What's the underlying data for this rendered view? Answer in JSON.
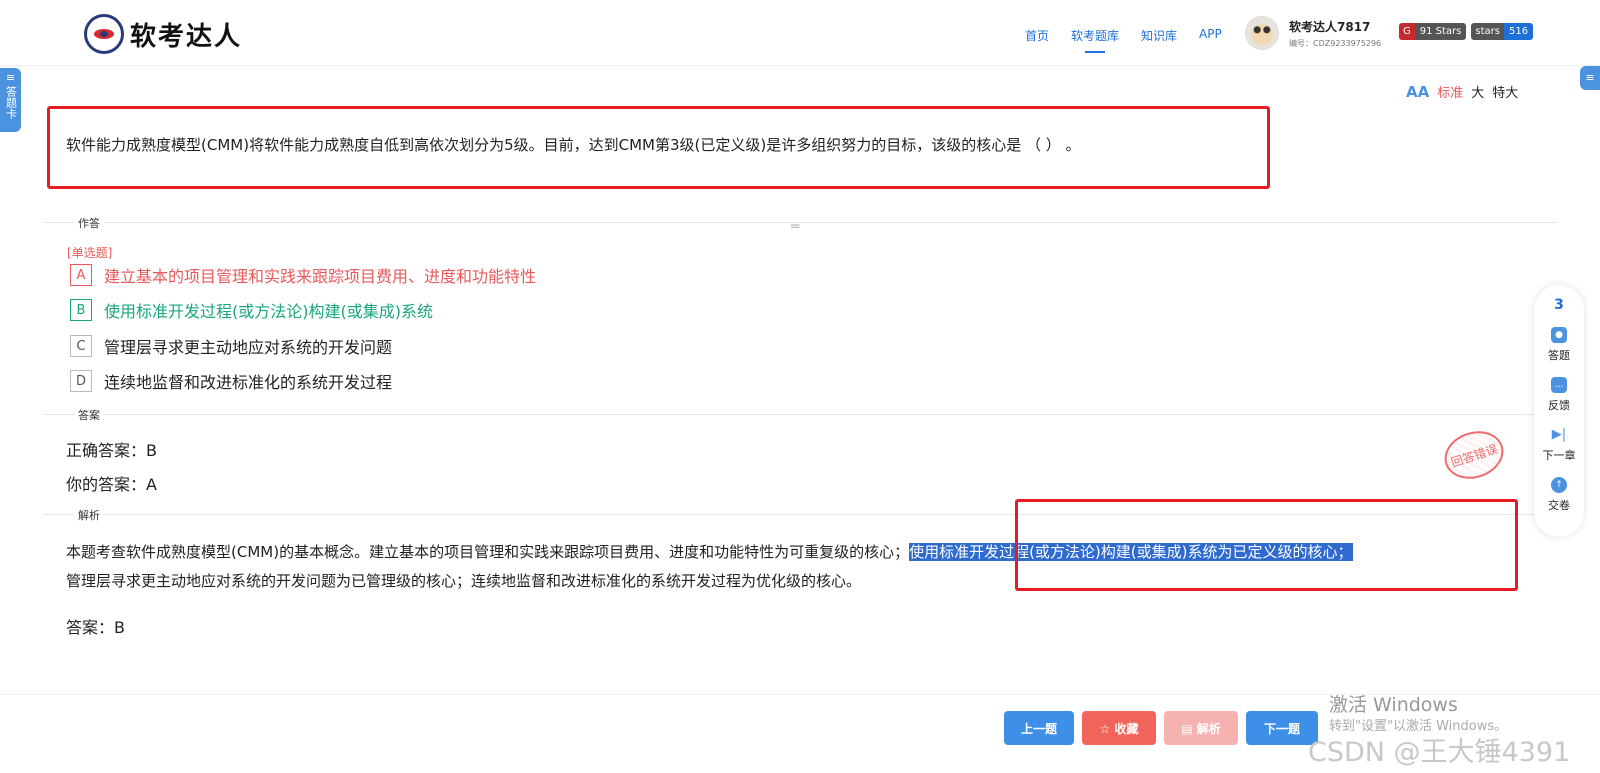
{
  "header": {
    "logo_text": "软考达人",
    "nav": [
      "首页",
      "软考题库",
      "知识库",
      "APP"
    ],
    "user_name": "软考达人7817",
    "user_id": "编号：CDZ9233975296",
    "badge_stars_left": "G",
    "badge_stars_right": "91 Stars",
    "badge_gh_left": "stars",
    "badge_gh_right": "516"
  },
  "sidebar_left_label": "答题卡",
  "font_size": {
    "icon": "AA",
    "standard": "标准",
    "large": "大",
    "xlarge": "特大"
  },
  "question": {
    "text": "软件能力成熟度模型(CMM)将软件能力成熟度自低到高依次划分为5级。目前，达到CMM第3级(已定义级)是许多组织努力的目标，该级的核心是 （ ） 。",
    "section_label": "作答",
    "type": "[单选题]",
    "options": [
      {
        "key": "A",
        "text": "建立基本的项目管理和实践来跟踪项目费用、进度和功能特性"
      },
      {
        "key": "B",
        "text": "使用标准开发过程(或方法论)构建(或集成)系统"
      },
      {
        "key": "C",
        "text": "管理层寻求更主动地应对系统的开发问题"
      },
      {
        "key": "D",
        "text": "连续地监督和改进标准化的系统开发过程"
      }
    ]
  },
  "answer": {
    "section_label": "答案",
    "correct": "正确答案：B",
    "yours": "你的答案：A",
    "stamp": "回答错误"
  },
  "analysis": {
    "section_label": "解析",
    "text_before": "本题考查软件成熟度模型(CMM)的基本概念。建立基本的项目管理和实践来跟踪项目费用、进度和功能特性为可重复级的核心；",
    "text_highlight": "使用标准开发过程(或方法论)构建(或集成)系统为已定义级的核心；",
    "text_after": "管理层寻求更主动地应对系统的开发问题为已管理级的核心；连续地监督和改进标准化的系统开发过程为优化级的核心。",
    "final": "答案：B"
  },
  "float_panel": {
    "count": "3",
    "items": [
      "答题",
      "反馈",
      "下一章",
      "交卷"
    ]
  },
  "footer": {
    "prev": "上一题",
    "fav": "☆ 收藏",
    "explain": "▤ 解析",
    "next": "下一题"
  },
  "watermark": {
    "activate": "激活 Windows",
    "activate_sub": "转到\"设置\"以激活 Windows。",
    "csdn": "CSDN @王大锤4391"
  },
  "colors": {
    "accent": "#1e6fd8",
    "wrong": "#e85a5a",
    "right": "#1aa67a",
    "highlight_box": "#e51c23"
  }
}
